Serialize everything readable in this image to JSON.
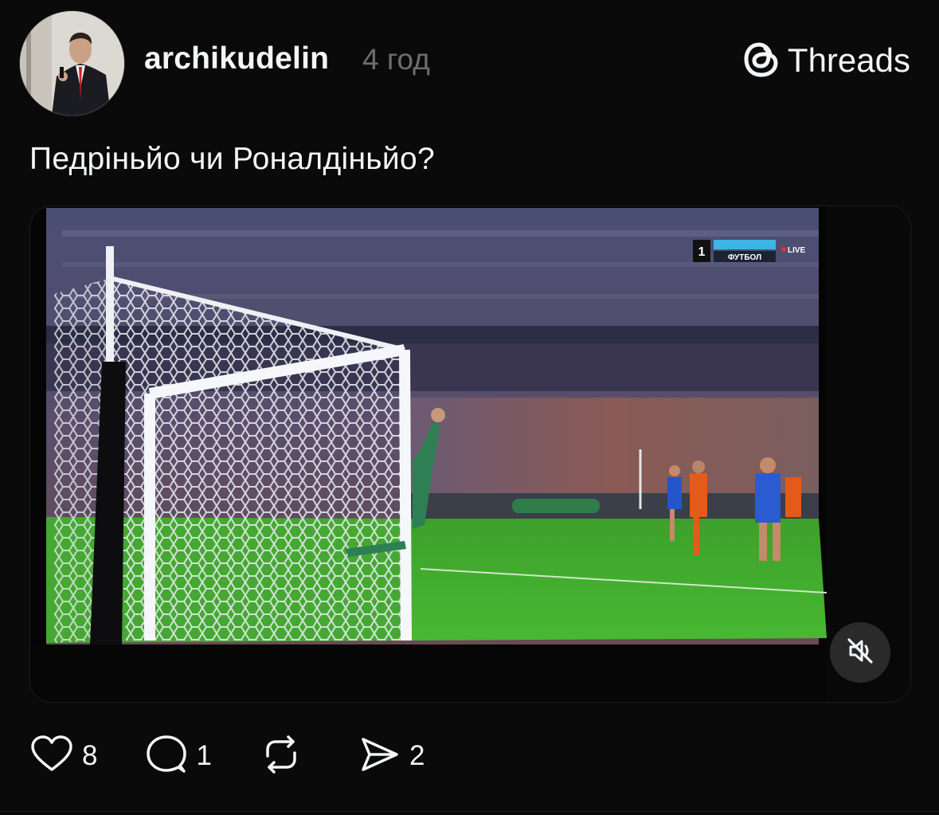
{
  "post": {
    "username": "archikudelin",
    "timestamp": "4 год",
    "caption": "Педріньйо чи Роналдіньйо?"
  },
  "brand": {
    "name": "Threads",
    "icon": "threads-logo-icon"
  },
  "video": {
    "description_icon": "video-frame",
    "score_digit": "1",
    "channel_label": "ФУТБОЛ",
    "live_label": "LIVE",
    "mute_icon": "speaker-muted-icon"
  },
  "actions": {
    "like_count": "8",
    "reply_count": "1",
    "repost_count": "",
    "share_count": "2"
  },
  "colors": {
    "background": "#0a0a0a",
    "text_primary": "#f3f5f7",
    "text_secondary": "#6e6e6e",
    "pitch_green": "#3fae2d",
    "live_red": "#e5322d"
  }
}
